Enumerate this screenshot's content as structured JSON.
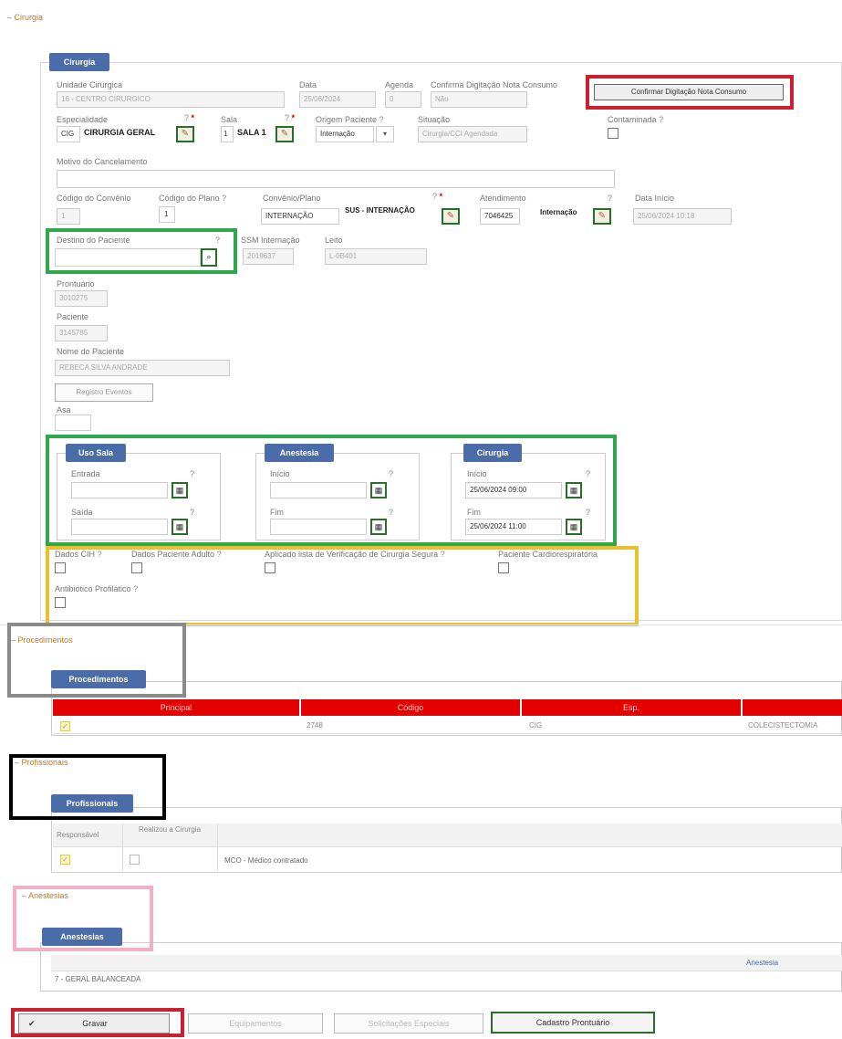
{
  "cirurgia_section": {
    "collapse_title": "Cirurgia",
    "tab_label": "Cirurgia",
    "unidade_label": "Unidade Cirúrgica",
    "unidade_value": "16 - CENTRO CIRURGICO",
    "data_label": "Data",
    "data_value": "25/06/2024",
    "agenda_label": "Agenda",
    "agenda_value": "0",
    "confirma_label": "Confirma Digitação Nota Consumo",
    "confirma_value": "Não",
    "confirm_button": "Confirmar Digitação Nota Consumo",
    "especialidade_label": "Especialidade",
    "especialidade_code": "CIG",
    "especialidade_name": "CIRURGIA GERAL",
    "sala_label": "Sala",
    "sala_code": "1",
    "sala_name": "SALA 1",
    "origem_label": "Origem Paciente",
    "origem_value": "Internação",
    "situacao_label": "Situação",
    "situacao_value": "Cirurgia/CCI Agendada",
    "contaminada_label": "Contaminada",
    "motivo_label": "Motivo do Cancelamento",
    "cod_convenio_label": "Código do Convênio",
    "cod_convenio_value": "1",
    "cod_plano_label": "Código do Plano",
    "cod_plano_value": "1",
    "convenio_label": "Convênio/Plano",
    "convenio_code": "INTERNAÇÃO",
    "convenio_name": "SUS - INTERNAÇÃO",
    "atendimento_label": "Atendimento",
    "atendimento_code": "7046425",
    "atendimento_name": "Internação",
    "data_inicio_label": "Data Início",
    "data_inicio_value": "25/06/2024 10:18",
    "destino_label": "Destino do Paciente",
    "ssm_label": "SSM Internação",
    "ssm_value": "2019637",
    "leito_label": "Leito",
    "leito_value": "L-0B401",
    "prontuario_label": "Prontuário",
    "prontuario_value": "3010275",
    "paciente_label": "Paciente",
    "paciente_value": "3145785",
    "nome_label": "Nome do Paciente",
    "nome_value": "REBECA SILVA ANDRADE",
    "registro_button": "Registro Eventos",
    "asa_label": "Asa"
  },
  "times": {
    "uso_sala": {
      "tab": "Uso Sala",
      "entrada_label": "Entrada",
      "saida_label": "Saída"
    },
    "anestesia": {
      "tab": "Anestesia",
      "inicio_label": "Início",
      "fim_label": "Fim"
    },
    "cirurgia": {
      "tab": "Cirurgia",
      "inicio_label": "Início",
      "inicio_value": "25/06/2024 09:00",
      "fim_label": "Fim",
      "fim_value": "25/06/2024 11:00"
    }
  },
  "flags": {
    "dados_cih": "Dados CIH",
    "dados_paciente": "Dados Paciente Adulto",
    "aplicado_lista": "Aplicado lista de Verificação de Cirurgia Segura",
    "paciente_cardio": "Paciente Cardiorespiratória",
    "antibiotico": "Antibiótico Profilático"
  },
  "procedimentos": {
    "collapse_title": "Procedimentos",
    "tab_label": "Procedimentos",
    "columns": [
      "Principal",
      "Código",
      "Esp.",
      ""
    ],
    "row": {
      "codigo": "2748",
      "esp": "CIG",
      "descricao": "COLECISTECTOMIA"
    }
  },
  "profissionais": {
    "collapse_title": "Profissionais",
    "tab_label": "Profissionais",
    "col_responsavel": "Responsável",
    "col_realizou": "Realizou a Cirurgia",
    "row_desc": "MCO - Médico contratado"
  },
  "anestesias": {
    "collapse_title": "Anestesias",
    "tab_label": "Anestesias",
    "col_anestesia": "Anestesia",
    "row": "7 - GERAL BALANCEADA"
  },
  "bottom_buttons": {
    "gravar": "Gravar",
    "equipamentos": "Equipamentos",
    "solicitacoes": "Solicitações Especiais",
    "cadastro": "Cadastro Prontuário"
  },
  "colors": {
    "tab_blue": "#4a6ca8",
    "highlight_red": "#cc1f2f",
    "highlight_green": "#2ea84a",
    "highlight_yellow": "#e8c22c",
    "highlight_gray": "#8a8a8a",
    "highlight_black": "#000000",
    "highlight_pink": "#f0b0c8",
    "table_header_red": "#e20000"
  }
}
